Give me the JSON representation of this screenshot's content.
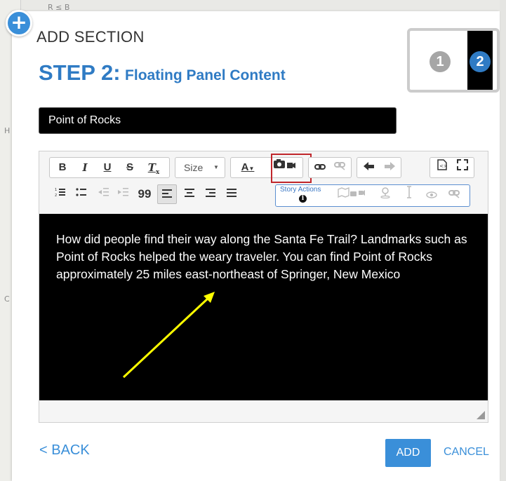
{
  "map": {
    "fragment_top": "R ≤ B",
    "fragment_left": "H",
    "fragment_left2": "C"
  },
  "header": {
    "add_section": "ADD SECTION",
    "step_label": "STEP 2:",
    "step_subtitle": "Floating Panel Content"
  },
  "steps": {
    "step1": "1",
    "step2": "2",
    "current": 2
  },
  "title_field": {
    "value": "Point of Rocks"
  },
  "toolbar": {
    "size_label": "Size",
    "story_actions_label": "Story Actions",
    "story_info": "i",
    "font_color_label": "A",
    "blockquote": "99",
    "icons": [
      "bold-icon",
      "italic-icon",
      "underline-icon",
      "strikethrough-icon",
      "clear-format-icon",
      "camera-video-icon",
      "link-icon",
      "unlink-icon",
      "undo-icon",
      "redo-icon",
      "source-icon",
      "fullscreen-icon",
      "numbered-list-icon",
      "bullet-list-icon",
      "outdent-icon",
      "indent-icon",
      "blockquote-icon",
      "align-left-icon",
      "align-center-icon",
      "align-right-icon",
      "justify-icon",
      "map-media-icon",
      "locate-icon",
      "height-icon",
      "eye-icon",
      "unlink-action-icon"
    ]
  },
  "editor": {
    "body_text": "How did people find their way along the Santa Fe Trail? Landmarks such as Point of Rocks helped the weary traveler. You can find Point of Rocks approximately 25 miles east-northeast of Springer, New Mexico"
  },
  "footer": {
    "back_label": "< BACK",
    "add_label": "ADD",
    "cancel_label": "CANCEL"
  },
  "colors": {
    "accent": "#2f7bc4",
    "button": "#3a8fd9",
    "highlight": "#c0262b",
    "annotation_arrow": "#ffff00"
  }
}
